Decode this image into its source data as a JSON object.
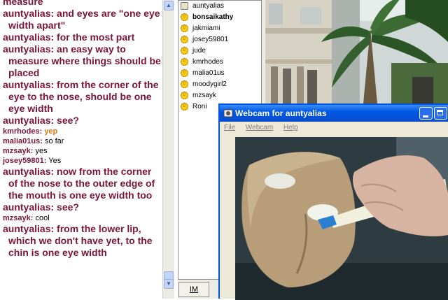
{
  "chat": {
    "top_partial": "measure",
    "messages": [
      {
        "nick": "auntyalias:",
        "text": "and eyes are \"one eye width apart\"",
        "style": "big"
      },
      {
        "nick": "auntyalias:",
        "text": "for the most part",
        "style": "big"
      },
      {
        "nick": "auntyalias:",
        "text": "an easy way to measure where things should be placed",
        "style": "big"
      },
      {
        "nick": "auntyalias:",
        "text": "from the corner of the eye to the nose, should be one eye width",
        "style": "big"
      },
      {
        "nick": "auntyalias:",
        "text": "see?",
        "style": "big"
      },
      {
        "nick": "kmrhodes:",
        "text": "yep",
        "style": "yep"
      },
      {
        "nick": "malia01us:",
        "text": "so far",
        "style": "small"
      },
      {
        "nick": "mzsayk:",
        "text": "yes",
        "style": "small"
      },
      {
        "nick": "josey59801:",
        "text": "Yes",
        "style": "small"
      },
      {
        "nick": "auntyalias:",
        "text": "now from the corner of the nose to the outer edge of the mouth is one eye width too",
        "style": "big"
      },
      {
        "nick": "auntyalias:",
        "text": "see?",
        "style": "big"
      },
      {
        "nick": "mzsayk:",
        "text": "cool",
        "style": "small"
      },
      {
        "nick": "auntyalias:",
        "text": "from the lower lip, which we don't have yet, to the chin is one eye width",
        "style": "big"
      }
    ]
  },
  "users": [
    {
      "name": "auntyalias",
      "icon": "webcam-icon",
      "bold": false
    },
    {
      "name": "bonsaikathy",
      "icon": "smiley-icon",
      "bold": true
    },
    {
      "name": "jakmiami",
      "icon": "smiley-icon",
      "bold": false
    },
    {
      "name": "josey59801",
      "icon": "smiley-icon",
      "bold": false
    },
    {
      "name": "jude",
      "icon": "smiley-icon",
      "bold": false
    },
    {
      "name": "kmrhodes",
      "icon": "smiley-icon",
      "bold": false
    },
    {
      "name": "malia01us",
      "icon": "smiley-icon",
      "bold": false
    },
    {
      "name": "moodygirl2",
      "icon": "smiley-icon",
      "bold": false
    },
    {
      "name": "mzsayk",
      "icon": "smiley-icon",
      "bold": false
    },
    {
      "name": "Roni",
      "icon": "smiley-icon",
      "bold": false
    }
  ],
  "im_button": "IM",
  "webcam": {
    "title": "Webcam for auntyalias",
    "menu": [
      "File",
      "Webcam",
      "Help"
    ]
  },
  "colors": {
    "nick": "#7b1535",
    "yep": "#d47b12",
    "titlebar": "#0058e3"
  }
}
